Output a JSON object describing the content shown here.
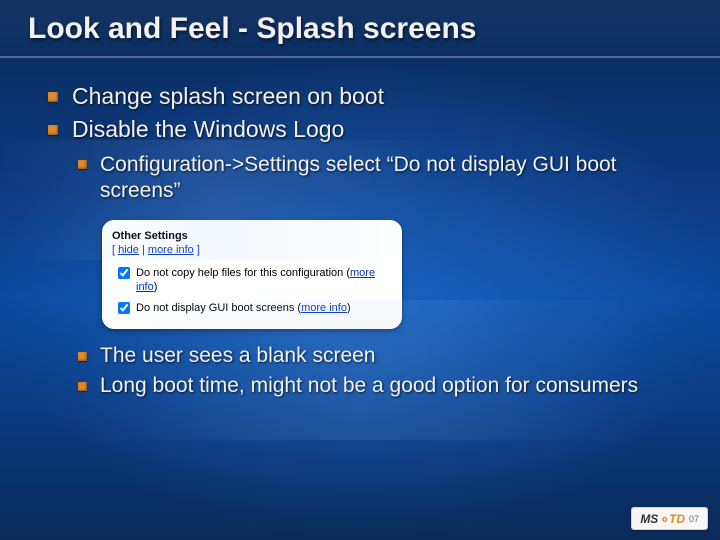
{
  "title": "Look and Feel - Splash screens",
  "bullets": {
    "b1": "Change splash screen on boot",
    "b2": "Disable the Windows Logo",
    "sub1": "Configuration->Settings select “Do not display GUI boot screens”",
    "sub2": "The user sees a blank screen",
    "sub3": "Long boot time, might not be a good option for consumers"
  },
  "panel": {
    "heading": "Other Settings",
    "links_prefix": "[ ",
    "hide": "hide",
    "links_sep": " | ",
    "more_info": "more info",
    "links_suffix": " ]",
    "row1_label": "Do not copy help files for this configuration",
    "row2_label": "Do not display GUI boot screens",
    "paren_open": " (",
    "paren_close": ")",
    "row_more_info": "more info"
  },
  "badge": {
    "ms": "MS",
    "chev": "‹›",
    "td": "TD",
    "year": "07"
  }
}
